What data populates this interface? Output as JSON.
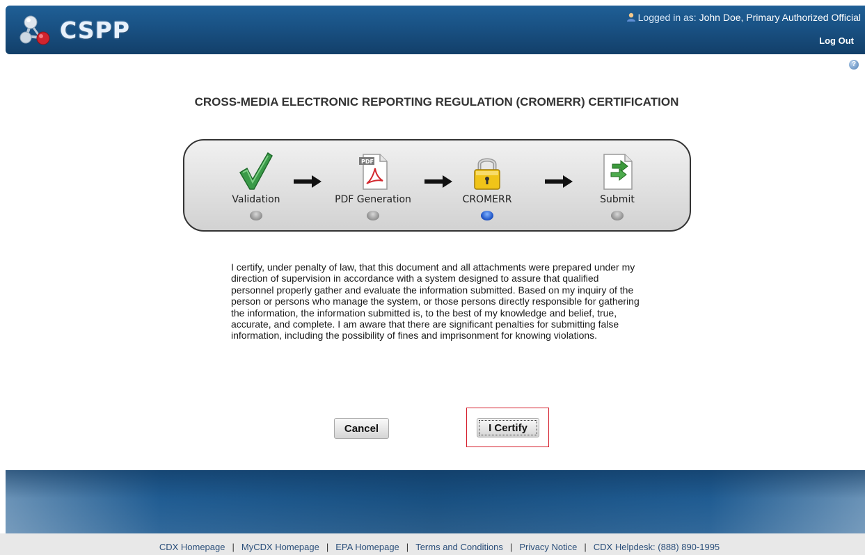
{
  "header": {
    "logo_text": "CSPP",
    "logged_in_prefix": "Logged in as: ",
    "user_name": "John Doe, Primary Authorized Official",
    "logout_label": "Log Out"
  },
  "help": {
    "glyph": "?"
  },
  "page_title": "CROSS-MEDIA ELECTRONIC REPORTING REGULATION (CROMERR) CERTIFICATION",
  "progress": {
    "steps": [
      {
        "label": "Validation",
        "icon": "checkmark-icon",
        "active": false
      },
      {
        "label": "PDF Generation",
        "icon": "pdf-document-icon",
        "active": false
      },
      {
        "label": "CROMERR",
        "icon": "padlock-icon",
        "active": true
      },
      {
        "label": "Submit",
        "icon": "submit-document-icon",
        "active": false
      }
    ],
    "pdf_badge": "PDF"
  },
  "certification_text": "I certify, under penalty of law, that this document and all attachments were prepared under my direction of supervision in accordance with a system designed to assure that qualified personnel properly gather and evaluate the information submitted. Based on my inquiry of the person or persons who manage the system, or those persons directly responsible for gathering the information, the information submitted is, to the best of my knowledge and belief, true, accurate, and complete. I am aware that there are significant penalties for submitting false information, including the possibility of fines and imprisonment for knowing violations.",
  "buttons": {
    "cancel": "Cancel",
    "certify": "I Certify"
  },
  "footer": {
    "links": [
      "CDX Homepage",
      "MyCDX Homepage",
      "EPA Homepage",
      "Terms and Conditions",
      "Privacy Notice",
      "CDX Helpdesk: (888) 890-1995"
    ],
    "separator": "|"
  },
  "colors": {
    "header_blue": "#184e7f",
    "active_step": "#1f55c7",
    "highlight_red": "#d51f2c"
  }
}
